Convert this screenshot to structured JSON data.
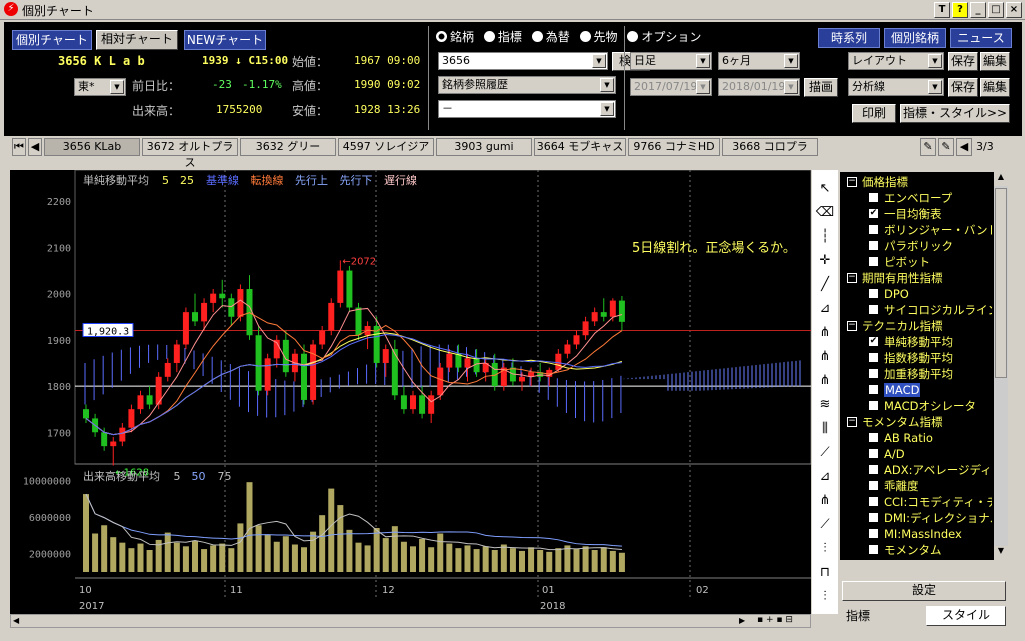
{
  "window": {
    "title": "個別チャート",
    "controls": [
      "T",
      "?",
      "_",
      "□",
      "×"
    ]
  },
  "topbuttons": {
    "individual": "個別チャート",
    "relative": "相対チャート",
    "new": "NEWチャート",
    "timeseries": "時系列",
    "indivstock": "個別銘柄",
    "news": "ニュース"
  },
  "quote": {
    "code_name": "3656 K L a b",
    "price": "1939 ↓ C15:00",
    "open_label": "始値：",
    "open": "1967 09:00",
    "prev_label": "前日比：",
    "change": "-23",
    "pct": "-1.17%",
    "high_label": "高値：",
    "high": "1990 09:02",
    "volume_label": "出来高：",
    "volume": "1755200",
    "low_label": "安値：",
    "low": "1928 13:26",
    "exchange": "東*"
  },
  "assetradio": [
    "銘柄",
    "指標",
    "為替",
    "先物",
    "オプション"
  ],
  "search": {
    "code": "3656",
    "button": "検索",
    "history": "銘柄参照履歴",
    "blank": "－"
  },
  "period": {
    "unit": "日足",
    "range": "6ヶ月",
    "from": "2017/07/19",
    "to": "2018/01/19",
    "draw": "描画"
  },
  "layout": {
    "layout": "レイアウト",
    "save": "保存",
    "edit": "編集",
    "analysis": "分析線",
    "save2": "保存",
    "edit2": "編集",
    "print": "印刷",
    "style": "指標・スタイル>>"
  },
  "tabs": [
    "3656 KLab",
    "3672 オルトプラス",
    "3632 グリー",
    "4597 ソレイジア",
    "3903 gumi",
    "3664 モブキャス",
    "9766 コナミHD",
    "3668 コロプラ"
  ],
  "tabpage": "3/3",
  "chart_data": {
    "type": "candlestick",
    "legend": [
      {
        "name": "単純移動平均",
        "color": "#c0c0c0"
      },
      {
        "name": "5",
        "color": "#ffff60"
      },
      {
        "name": "25",
        "color": "#ffff60"
      },
      {
        "name": "基準線",
        "color": "#5a6cff"
      },
      {
        "name": "転換線",
        "color": "#ff7a3a"
      },
      {
        "name": "先行上",
        "color": "#8aa8ff"
      },
      {
        "name": "先行下",
        "color": "#8aa8ff"
      },
      {
        "name": "遅行線",
        "color": "#ffc8c8"
      }
    ],
    "yticks": [
      "2200",
      "2100",
      "2000",
      "1900",
      "1800",
      "1700"
    ],
    "ylim": [
      1640,
      2220
    ],
    "annotation_high": "←2072",
    "annotation_low": "←1628",
    "current_label": "1,920.3",
    "comment": "5日線割れ。正念場くるか。",
    "volume_legend": [
      {
        "name": "出来高移動平均",
        "color": "#c0c0c0"
      },
      {
        "name": "5",
        "color": "#c0c0c0"
      },
      {
        "name": "50",
        "color": "#8aa8ff"
      },
      {
        "name": "75",
        "color": "#c0c0c0"
      }
    ],
    "vticks": [
      "10000000",
      "6000000",
      "2000000"
    ],
    "xticks": [
      "10",
      "11",
      "12",
      "01",
      "02"
    ],
    "years": [
      "2017",
      "2018"
    ],
    "candles": [
      [
        1750,
        1760,
        1720,
        1730
      ],
      [
        1730,
        1740,
        1690,
        1700
      ],
      [
        1700,
        1710,
        1660,
        1670
      ],
      [
        1670,
        1690,
        1628,
        1680
      ],
      [
        1680,
        1720,
        1670,
        1710
      ],
      [
        1710,
        1760,
        1700,
        1750
      ],
      [
        1750,
        1790,
        1740,
        1780
      ],
      [
        1780,
        1800,
        1750,
        1760
      ],
      [
        1760,
        1830,
        1750,
        1820
      ],
      [
        1820,
        1860,
        1810,
        1850
      ],
      [
        1850,
        1900,
        1830,
        1890
      ],
      [
        1890,
        1970,
        1880,
        1960
      ],
      [
        1960,
        2000,
        1930,
        1940
      ],
      [
        1940,
        1990,
        1920,
        1980
      ],
      [
        1980,
        2010,
        1960,
        2000
      ],
      [
        2000,
        2030,
        1970,
        1990
      ],
      [
        1990,
        2000,
        1930,
        1950
      ],
      [
        1950,
        2020,
        1940,
        2010
      ],
      [
        2010,
        2040,
        1900,
        1910
      ],
      [
        1910,
        1930,
        1780,
        1790
      ],
      [
        1790,
        1870,
        1780,
        1860
      ],
      [
        1860,
        1910,
        1840,
        1900
      ],
      [
        1900,
        1920,
        1820,
        1830
      ],
      [
        1830,
        1880,
        1810,
        1870
      ],
      [
        1870,
        1890,
        1760,
        1770
      ],
      [
        1770,
        1900,
        1760,
        1890
      ],
      [
        1890,
        1930,
        1880,
        1920
      ],
      [
        1920,
        1990,
        1910,
        1980
      ],
      [
        1980,
        2072,
        1970,
        2050
      ],
      [
        2050,
        2060,
        1960,
        1970
      ],
      [
        1970,
        1980,
        1900,
        1910
      ],
      [
        1910,
        1940,
        1880,
        1930
      ],
      [
        1930,
        1950,
        1840,
        1850
      ],
      [
        1850,
        1890,
        1820,
        1880
      ],
      [
        1880,
        1900,
        1770,
        1780
      ],
      [
        1780,
        1800,
        1740,
        1750
      ],
      [
        1750,
        1790,
        1740,
        1780
      ],
      [
        1780,
        1800,
        1730,
        1740
      ],
      [
        1740,
        1790,
        1720,
        1780
      ],
      [
        1780,
        1850,
        1770,
        1840
      ],
      [
        1840,
        1880,
        1830,
        1870
      ],
      [
        1870,
        1890,
        1830,
        1840
      ],
      [
        1840,
        1870,
        1810,
        1860
      ],
      [
        1860,
        1880,
        1820,
        1830
      ],
      [
        1830,
        1860,
        1810,
        1850
      ],
      [
        1850,
        1870,
        1790,
        1800
      ],
      [
        1800,
        1850,
        1790,
        1840
      ],
      [
        1840,
        1860,
        1800,
        1810
      ],
      [
        1810,
        1830,
        1790,
        1820
      ],
      [
        1820,
        1840,
        1800,
        1830
      ],
      [
        1830,
        1850,
        1810,
        1820
      ],
      [
        1820,
        1840,
        1800,
        1835
      ],
      [
        1835,
        1880,
        1830,
        1870
      ],
      [
        1870,
        1900,
        1860,
        1890
      ],
      [
        1890,
        1920,
        1880,
        1910
      ],
      [
        1910,
        1950,
        1900,
        1940
      ],
      [
        1940,
        1970,
        1930,
        1960
      ],
      [
        1960,
        1990,
        1940,
        1950
      ],
      [
        1950,
        1990,
        1940,
        1985
      ],
      [
        1985,
        1995,
        1920,
        1939
      ]
    ],
    "volumes": [
      8.5,
      4.2,
      5.1,
      3.8,
      3.2,
      2.6,
      3.1,
      2.4,
      3.5,
      4.3,
      3.2,
      2.8,
      3.4,
      2.5,
      2.9,
      3.1,
      2.6,
      5.3,
      9.8,
      5.1,
      4.1,
      3.3,
      3.9,
      3.0,
      2.7,
      4.4,
      6.2,
      9.1,
      7.3,
      4.6,
      3.2,
      2.9,
      4.8,
      3.7,
      5.0,
      3.3,
      2.8,
      3.6,
      2.7,
      4.2,
      3.1,
      2.6,
      2.9,
      2.5,
      2.8,
      2.4,
      3.0,
      2.6,
      2.3,
      2.7,
      2.4,
      2.2,
      2.6,
      2.9,
      2.5,
      2.8,
      2.4,
      2.7,
      2.3,
      2.1
    ]
  },
  "tools": [
    "cursor",
    "eraser",
    "vertical-line",
    "cross",
    "trend",
    "fibonacci",
    "fan",
    "gann-fan",
    "pitchfork",
    "channel",
    "speed-line",
    "cycle",
    "ratio",
    "gann",
    "angle",
    "percent",
    "range",
    "grid"
  ],
  "indicator_tree": [
    {
      "cat": "価格指標",
      "items": [
        {
          "label": "エンベロープ",
          "checked": false
        },
        {
          "label": "一目均衡表",
          "checked": true
        },
        {
          "label": "ボリンジャー・バンド",
          "checked": false
        },
        {
          "label": "パラボリック",
          "checked": false
        },
        {
          "label": "ピボット",
          "checked": false
        }
      ]
    },
    {
      "cat": "期間有用性指標",
      "items": [
        {
          "label": "DPO",
          "checked": false
        },
        {
          "label": "サイコロジカルライン",
          "checked": false
        }
      ]
    },
    {
      "cat": "テクニカル指標",
      "items": [
        {
          "label": "単純移動平均",
          "checked": true
        },
        {
          "label": "指数移動平均",
          "checked": false
        },
        {
          "label": "加重移動平均",
          "checked": false
        },
        {
          "label": "MACD",
          "checked": false,
          "highlight": true
        },
        {
          "label": "MACDオシレータ",
          "checked": false
        }
      ]
    },
    {
      "cat": "モメンタム指標",
      "items": [
        {
          "label": "AB Ratio",
          "checked": false
        },
        {
          "label": "A/D",
          "checked": false
        },
        {
          "label": "ADX:アベレージディレ",
          "checked": false
        },
        {
          "label": "乖離度",
          "checked": false
        },
        {
          "label": "CCI:コモディティ・チャ",
          "checked": false
        },
        {
          "label": "DMI:ディレクショナル",
          "checked": false
        },
        {
          "label": "MI:MassIndex",
          "checked": false
        },
        {
          "label": "モメンタム",
          "checked": false
        }
      ]
    }
  ],
  "panelbuttons": {
    "settings": "設定",
    "tab_indicator": "指標",
    "tab_style": "スタイル"
  }
}
